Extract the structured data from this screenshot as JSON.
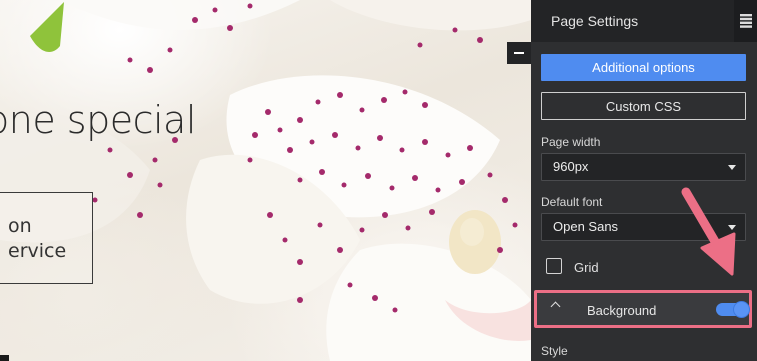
{
  "canvas": {
    "hero_title": "one special",
    "box_text": "on\nervice"
  },
  "panel": {
    "title": "Page Settings",
    "tab_icon": "list-icon",
    "collapse_icon": "minus-icon",
    "additional_options_label": "Additional options",
    "custom_css_label": "Custom CSS",
    "page_width": {
      "label": "Page width",
      "value": "960px"
    },
    "default_font": {
      "label": "Default font",
      "value": "Open Sans"
    },
    "grid": {
      "label": "Grid",
      "checked": false
    },
    "background": {
      "label": "Background",
      "enabled": true,
      "expanded": true
    },
    "style": {
      "label": "Style"
    }
  },
  "colors": {
    "panel_bg": "#2e2f31",
    "header_bg": "#232426",
    "accent": "#4f8cf0",
    "highlight": "#ec6f86"
  }
}
